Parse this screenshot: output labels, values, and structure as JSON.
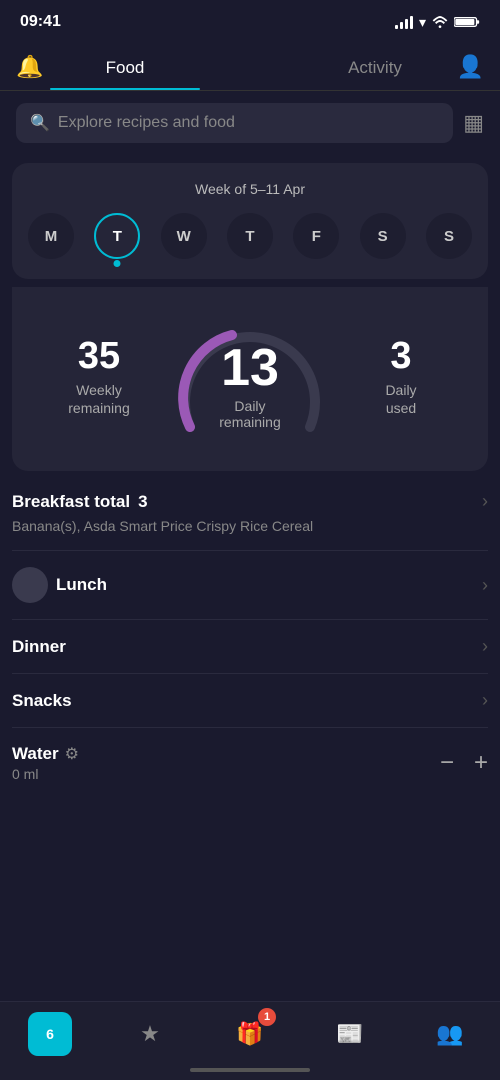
{
  "statusBar": {
    "time": "09:41"
  },
  "tabs": {
    "food": "Food",
    "activity": "Activity"
  },
  "search": {
    "placeholder": "Explore recipes and food"
  },
  "week": {
    "label": "Week of 5–11 Apr",
    "days": [
      {
        "short": "M",
        "active": false
      },
      {
        "short": "T",
        "active": true
      },
      {
        "short": "W",
        "active": false
      },
      {
        "short": "T",
        "active": false
      },
      {
        "short": "F",
        "active": false
      },
      {
        "short": "S",
        "active": false
      },
      {
        "short": "S",
        "active": false
      }
    ]
  },
  "stats": {
    "weeklyRemaining": "35",
    "weeklyLabel": "Weekly\nremaining",
    "dailyRemaining": "13",
    "dailyRemainingLabel": "Daily\nremaining",
    "dailyUsed": "3",
    "dailyUsedLabel": "Daily\nused"
  },
  "meals": {
    "breakfast": {
      "title": "Breakfast total",
      "count": "3",
      "foods": "Banana(s), Asda Smart Price Crispy Rice Cereal"
    },
    "lunch": {
      "title": "Lunch"
    },
    "dinner": {
      "title": "Dinner"
    },
    "snacks": {
      "title": "Snacks"
    }
  },
  "water": {
    "title": "Water",
    "value": "0 ml",
    "minusLabel": "−",
    "plusLabel": "+"
  },
  "bottomNav": {
    "calendar": "6",
    "badge": "1"
  }
}
